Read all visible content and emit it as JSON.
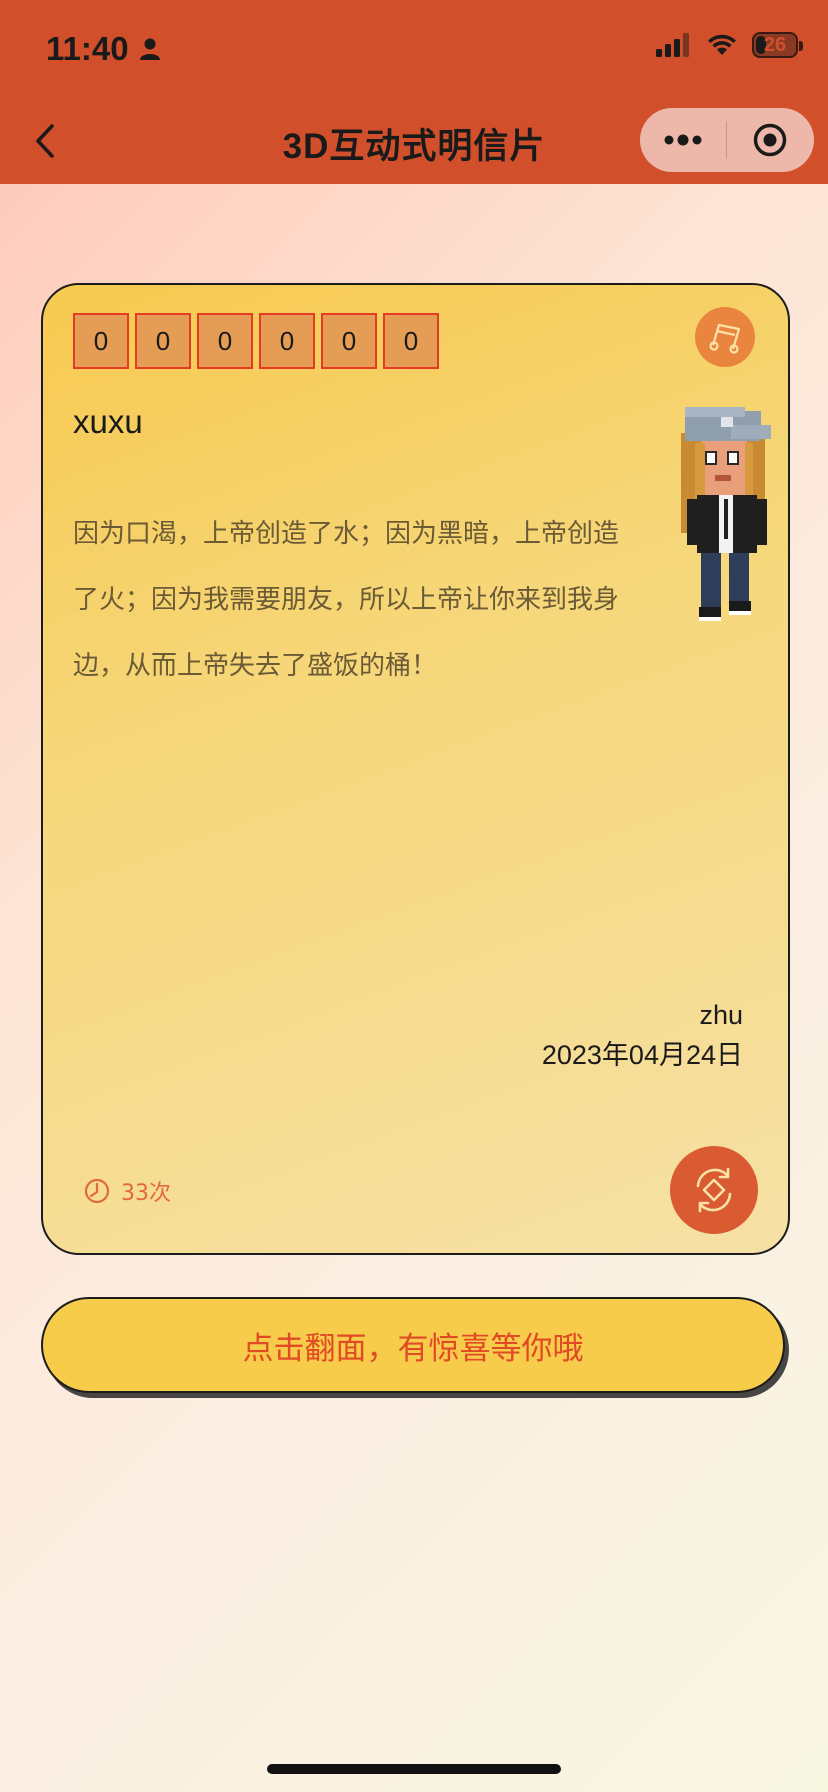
{
  "status_bar": {
    "time": "11:40",
    "battery": "26",
    "battery_level": 0.26,
    "icons": [
      "person-icon",
      "signal-icon",
      "wifi-icon",
      "battery-icon"
    ]
  },
  "nav": {
    "title": "3D互动式明信片",
    "back_icon": "chevron-left-icon",
    "more_icon": "more-dots-icon",
    "close_icon": "target-close-icon"
  },
  "card": {
    "code_digits": [
      "0",
      "0",
      "0",
      "0",
      "0",
      "0"
    ],
    "recipient": "xuxu",
    "message": "因为口渴，上帝创造了水；因为黑暗，上帝创造了火；因为我需要朋友，所以上帝让你来到我身边，从而上帝失去了盛饭的桶！",
    "sender": "zhu",
    "date": "2023年04月24日",
    "views": "33次",
    "music_icon": "music-note-icon",
    "flip_icon": "rotate-flip-icon"
  },
  "cta": {
    "label": "点击翻面，有惊喜等你哦"
  },
  "colors": {
    "header": "#d14f2a",
    "accent": "#e04a25",
    "card_gradient_start": "#f7c94f",
    "card_gradient_end": "#f6e1a6",
    "cta_bg": "#f7cc4a"
  }
}
